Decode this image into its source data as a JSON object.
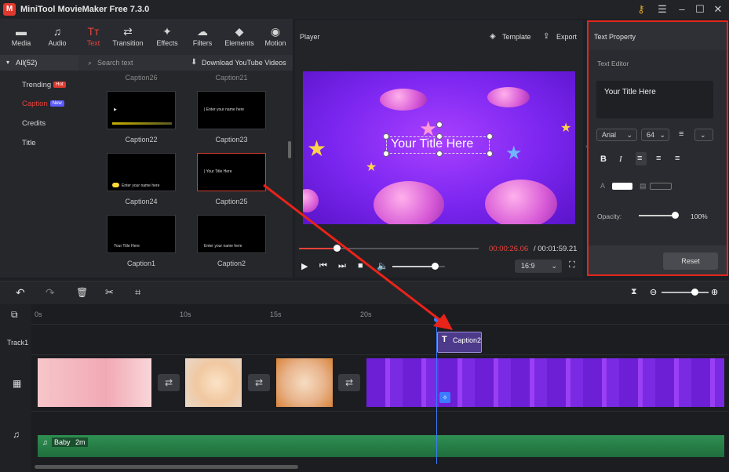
{
  "window": {
    "title": "MiniTool MovieMaker Free 7.3.0",
    "logo": "M"
  },
  "toolbar": {
    "items": [
      {
        "label": "Media",
        "icon": "folder-icon",
        "glyph": "▬"
      },
      {
        "label": "Audio",
        "icon": "music-note-icon",
        "glyph": "♫"
      },
      {
        "label": "Text",
        "icon": "text-icon",
        "glyph": "Tт"
      },
      {
        "label": "Transition",
        "icon": "transition-icon",
        "glyph": "⇄"
      },
      {
        "label": "Effects",
        "icon": "effects-icon",
        "glyph": "✦"
      },
      {
        "label": "Filters",
        "icon": "filters-icon",
        "glyph": "☁"
      },
      {
        "label": "Elements",
        "icon": "elements-icon",
        "glyph": "◆"
      },
      {
        "label": "Motion",
        "icon": "motion-icon",
        "glyph": "◉"
      }
    ]
  },
  "library": {
    "all_label": "All(52)",
    "search_placeholder": "Search text",
    "download_label": "Download YouTube Videos",
    "categories": [
      {
        "label": "Trending",
        "badge": "Hot"
      },
      {
        "label": "Caption",
        "badge": "New"
      },
      {
        "label": "Credits"
      },
      {
        "label": "Title"
      }
    ],
    "partial_labels": [
      "Caption26",
      "Caption21"
    ],
    "thumbs": [
      {
        "label": "Caption22",
        "text": "▶ "
      },
      {
        "label": "Caption23",
        "text": "| Enter your name here"
      },
      {
        "label": "Caption24",
        "text": "Enter your name here"
      },
      {
        "label": "Caption25",
        "text": "| Your Title Here"
      },
      {
        "label": "Caption1",
        "text": "Your Title Here"
      },
      {
        "label": "Caption2",
        "text": "Enter your name here"
      }
    ]
  },
  "player": {
    "title": "Player",
    "template_label": "Template",
    "export_label": "Export",
    "overlay_text": "Your Title Here",
    "current_time": "00:00:26.06",
    "total_time": "/ 00:01:59.21",
    "aspect": "16:9",
    "progress": 0.21,
    "volume": 0.8
  },
  "text_property": {
    "header": "Text Property",
    "editor_label": "Text Editor",
    "editor_value": "Your Title Here",
    "font": "Arial",
    "size": "64",
    "opacity_label": "Opacity:",
    "opacity_value": "100%",
    "opacity": 1.0,
    "reset_label": "Reset",
    "format_buttons": [
      "B",
      "I"
    ]
  },
  "timeline": {
    "ruler": [
      "0s",
      "10s",
      "15s",
      "20s"
    ],
    "track_label": "Track1",
    "text_clip": "Caption2",
    "audio_label": "Baby",
    "audio_duration": "2m",
    "zoom": 0.7
  },
  "colors": {
    "accent": "#e8433a",
    "highlight": "#e2271c",
    "playhead": "#3a7bff"
  }
}
